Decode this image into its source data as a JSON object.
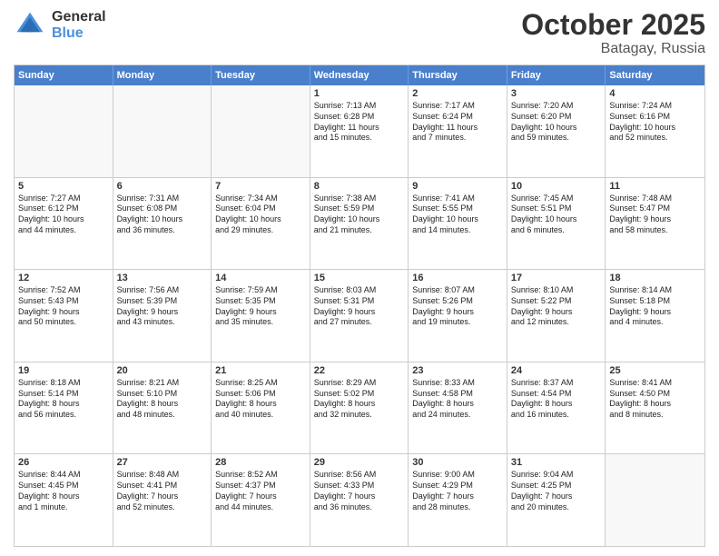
{
  "logo": {
    "general": "General",
    "blue": "Blue"
  },
  "title": "October 2025",
  "location": "Batagay, Russia",
  "header_days": [
    "Sunday",
    "Monday",
    "Tuesday",
    "Wednesday",
    "Thursday",
    "Friday",
    "Saturday"
  ],
  "weeks": [
    [
      {
        "day": "",
        "text": "",
        "empty": true
      },
      {
        "day": "",
        "text": "",
        "empty": true
      },
      {
        "day": "",
        "text": "",
        "empty": true
      },
      {
        "day": "1",
        "text": "Sunrise: 7:13 AM\nSunset: 6:28 PM\nDaylight: 11 hours\nand 15 minutes."
      },
      {
        "day": "2",
        "text": "Sunrise: 7:17 AM\nSunset: 6:24 PM\nDaylight: 11 hours\nand 7 minutes."
      },
      {
        "day": "3",
        "text": "Sunrise: 7:20 AM\nSunset: 6:20 PM\nDaylight: 10 hours\nand 59 minutes."
      },
      {
        "day": "4",
        "text": "Sunrise: 7:24 AM\nSunset: 6:16 PM\nDaylight: 10 hours\nand 52 minutes."
      }
    ],
    [
      {
        "day": "5",
        "text": "Sunrise: 7:27 AM\nSunset: 6:12 PM\nDaylight: 10 hours\nand 44 minutes."
      },
      {
        "day": "6",
        "text": "Sunrise: 7:31 AM\nSunset: 6:08 PM\nDaylight: 10 hours\nand 36 minutes."
      },
      {
        "day": "7",
        "text": "Sunrise: 7:34 AM\nSunset: 6:04 PM\nDaylight: 10 hours\nand 29 minutes."
      },
      {
        "day": "8",
        "text": "Sunrise: 7:38 AM\nSunset: 5:59 PM\nDaylight: 10 hours\nand 21 minutes."
      },
      {
        "day": "9",
        "text": "Sunrise: 7:41 AM\nSunset: 5:55 PM\nDaylight: 10 hours\nand 14 minutes."
      },
      {
        "day": "10",
        "text": "Sunrise: 7:45 AM\nSunset: 5:51 PM\nDaylight: 10 hours\nand 6 minutes."
      },
      {
        "day": "11",
        "text": "Sunrise: 7:48 AM\nSunset: 5:47 PM\nDaylight: 9 hours\nand 58 minutes."
      }
    ],
    [
      {
        "day": "12",
        "text": "Sunrise: 7:52 AM\nSunset: 5:43 PM\nDaylight: 9 hours\nand 50 minutes."
      },
      {
        "day": "13",
        "text": "Sunrise: 7:56 AM\nSunset: 5:39 PM\nDaylight: 9 hours\nand 43 minutes."
      },
      {
        "day": "14",
        "text": "Sunrise: 7:59 AM\nSunset: 5:35 PM\nDaylight: 9 hours\nand 35 minutes."
      },
      {
        "day": "15",
        "text": "Sunrise: 8:03 AM\nSunset: 5:31 PM\nDaylight: 9 hours\nand 27 minutes."
      },
      {
        "day": "16",
        "text": "Sunrise: 8:07 AM\nSunset: 5:26 PM\nDaylight: 9 hours\nand 19 minutes."
      },
      {
        "day": "17",
        "text": "Sunrise: 8:10 AM\nSunset: 5:22 PM\nDaylight: 9 hours\nand 12 minutes."
      },
      {
        "day": "18",
        "text": "Sunrise: 8:14 AM\nSunset: 5:18 PM\nDaylight: 9 hours\nand 4 minutes."
      }
    ],
    [
      {
        "day": "19",
        "text": "Sunrise: 8:18 AM\nSunset: 5:14 PM\nDaylight: 8 hours\nand 56 minutes."
      },
      {
        "day": "20",
        "text": "Sunrise: 8:21 AM\nSunset: 5:10 PM\nDaylight: 8 hours\nand 48 minutes."
      },
      {
        "day": "21",
        "text": "Sunrise: 8:25 AM\nSunset: 5:06 PM\nDaylight: 8 hours\nand 40 minutes."
      },
      {
        "day": "22",
        "text": "Sunrise: 8:29 AM\nSunset: 5:02 PM\nDaylight: 8 hours\nand 32 minutes."
      },
      {
        "day": "23",
        "text": "Sunrise: 8:33 AM\nSunset: 4:58 PM\nDaylight: 8 hours\nand 24 minutes."
      },
      {
        "day": "24",
        "text": "Sunrise: 8:37 AM\nSunset: 4:54 PM\nDaylight: 8 hours\nand 16 minutes."
      },
      {
        "day": "25",
        "text": "Sunrise: 8:41 AM\nSunset: 4:50 PM\nDaylight: 8 hours\nand 8 minutes."
      }
    ],
    [
      {
        "day": "26",
        "text": "Sunrise: 8:44 AM\nSunset: 4:45 PM\nDaylight: 8 hours\nand 1 minute."
      },
      {
        "day": "27",
        "text": "Sunrise: 8:48 AM\nSunset: 4:41 PM\nDaylight: 7 hours\nand 52 minutes."
      },
      {
        "day": "28",
        "text": "Sunrise: 8:52 AM\nSunset: 4:37 PM\nDaylight: 7 hours\nand 44 minutes."
      },
      {
        "day": "29",
        "text": "Sunrise: 8:56 AM\nSunset: 4:33 PM\nDaylight: 7 hours\nand 36 minutes."
      },
      {
        "day": "30",
        "text": "Sunrise: 9:00 AM\nSunset: 4:29 PM\nDaylight: 7 hours\nand 28 minutes."
      },
      {
        "day": "31",
        "text": "Sunrise: 9:04 AM\nSunset: 4:25 PM\nDaylight: 7 hours\nand 20 minutes."
      },
      {
        "day": "",
        "text": "",
        "empty": true
      }
    ]
  ]
}
